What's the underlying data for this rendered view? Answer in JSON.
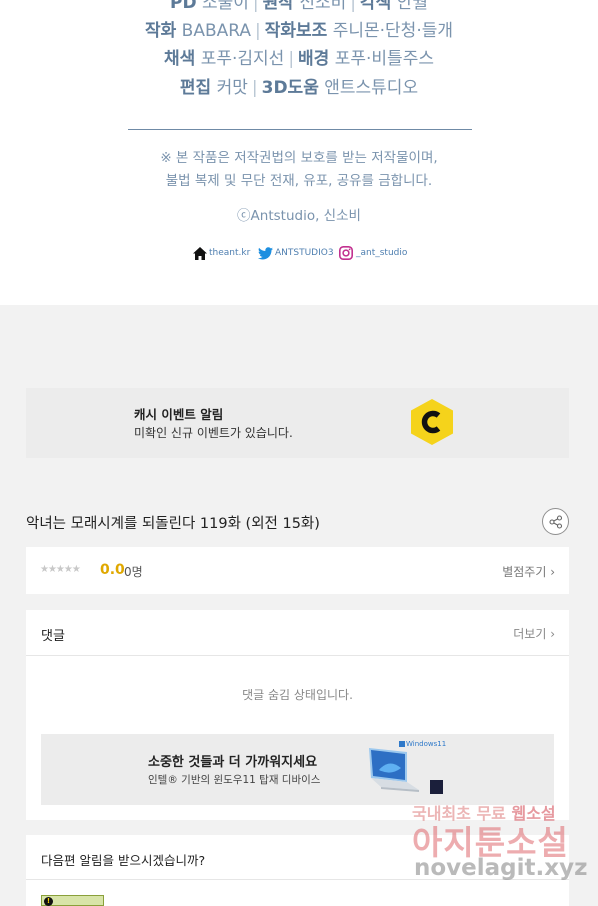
{
  "credits": {
    "line0": {
      "label1": "PD",
      "value1": "소울이",
      "label2": "원작",
      "value2": "신소비",
      "label3": "각색",
      "value3": "안월"
    },
    "line1": {
      "label1": "작화",
      "value1": "BABARA",
      "label2": "작화보조",
      "value2": "주니몬·단청·들개"
    },
    "line2": {
      "label1": "채색",
      "value1": "포푸·김지선",
      "label2": "배경",
      "value2": "포푸·비틀주스"
    },
    "line3": {
      "label1": "편집",
      "value1": "커맛",
      "label2": "3D도움",
      "value2": "앤트스튜디오"
    },
    "notice_line1": "※ 본 작품은 저작권법의 보호를 받는 저작물이며,",
    "notice_line2": "불법 복제 및 무단 전재, 유포, 공유를 금합니다.",
    "copyright": "ⓒAntstudio, 신소비",
    "social": {
      "home": "theant.kr",
      "twitter": "ANTSTUDIO3",
      "instagram": "_ant_studio"
    }
  },
  "cash_event": {
    "title": "캐시 이벤트 알림",
    "description": "미확인 신규 이벤트가 있습니다.",
    "logo_letter": "C",
    "logo_color": "#f5d31b"
  },
  "episode": {
    "title": "악녀는 모래시계를 되돌린다 119화 (외전 15화)"
  },
  "rating": {
    "stars": "★★★★★",
    "score": "0.0",
    "count": "0명",
    "rate_link": "별점주기 ›"
  },
  "comments": {
    "title": "댓글",
    "more_link": "더보기 ›",
    "hidden_message": "댓글 숨김 상태입니다."
  },
  "ad": {
    "title": "소중한 것들과 더 가까워지세요",
    "description": "인텔® 기반의 윈도우11 탑재 디바이스",
    "windows_label": "Windows11"
  },
  "next_alarm": {
    "title": "다음편 알림을 받으시겠습니까?"
  },
  "watermark": {
    "line1_prefix": "국내최초 무료 ",
    "line1_highlight": "웹소설",
    "line2": "아지툰소설",
    "line3": "novelagit.xyz"
  },
  "colors": {
    "credit_text": "#7a93ad",
    "score": "#e0a800",
    "page_bg": "#f2f2f2"
  }
}
